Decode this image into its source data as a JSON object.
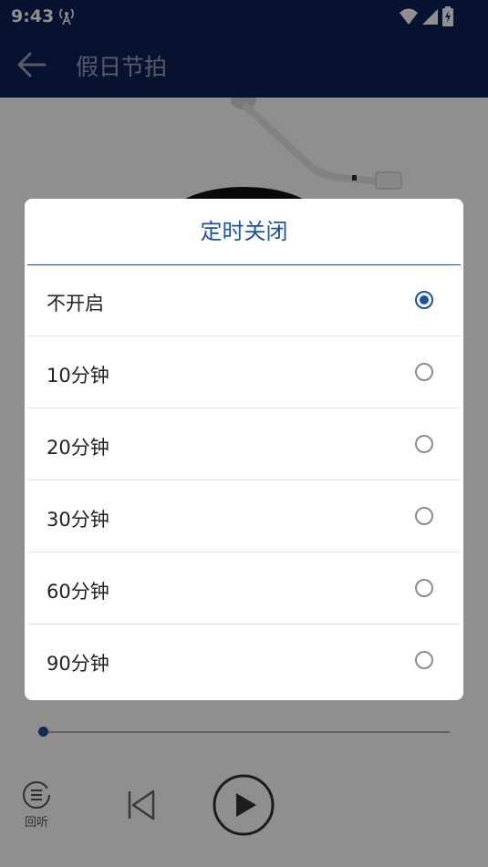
{
  "status_bar": {
    "time": "9:43",
    "left_icon": "hotspot-icon",
    "right_icons": [
      "wifi-icon",
      "signal-icon",
      "battery-icon"
    ]
  },
  "app_bar": {
    "back_icon": "arrow-left-icon",
    "title": "假日节拍"
  },
  "player": {
    "history_label": "回听",
    "progress": 0,
    "icons": [
      "history-icon",
      "previous-icon",
      "play-icon"
    ]
  },
  "dialog": {
    "title": "定时关闭",
    "selected_index": 0,
    "options": [
      {
        "label": "不开启"
      },
      {
        "label": "10分钟"
      },
      {
        "label": "20分钟"
      },
      {
        "label": "30分钟"
      },
      {
        "label": "60分钟"
      },
      {
        "label": "90分钟"
      }
    ]
  },
  "colors": {
    "app_bar": "#0b2154",
    "accent": "#1c52a6"
  }
}
